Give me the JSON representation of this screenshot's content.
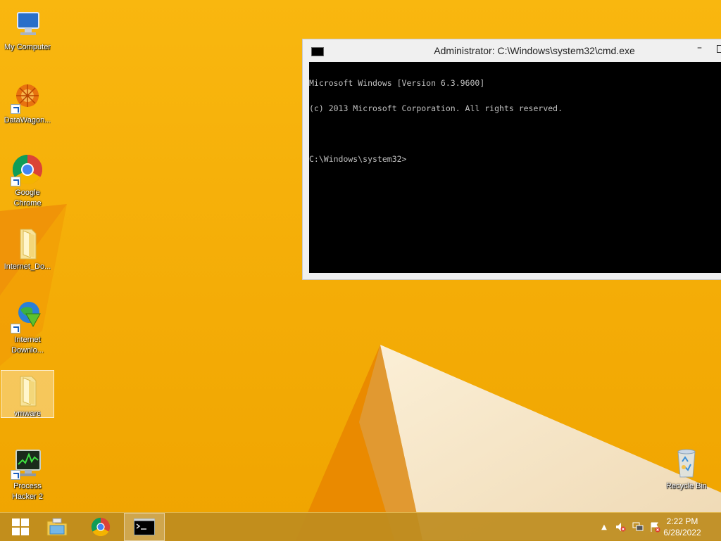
{
  "desktop": {
    "icons": [
      {
        "label": "My Computer",
        "icon": "computer-icon"
      },
      {
        "label": "DataWagon...",
        "icon": "datawagon-icon"
      },
      {
        "label": "Google Chrome",
        "icon": "chrome-icon"
      },
      {
        "label": "Internet_Do...",
        "icon": "folder-icon"
      },
      {
        "label": "Internet Downlo...",
        "icon": "idm-icon"
      },
      {
        "label": "vmware",
        "icon": "folder-icon"
      },
      {
        "label": "Process Hacker 2",
        "icon": "process-hacker-icon"
      },
      {
        "label": "Recycle Bin",
        "icon": "recycle-bin-icon"
      }
    ]
  },
  "cmd": {
    "title": "Administrator: C:\\Windows\\system32\\cmd.exe",
    "minimize": "–",
    "lines": [
      "Microsoft Windows [Version 6.3.9600]",
      "(c) 2013 Microsoft Corporation. All rights reserved.",
      "",
      "C:\\Windows\\system32>"
    ]
  },
  "taskbar": {
    "apps": [
      {
        "name": "start",
        "icon": "windows-logo-icon"
      },
      {
        "name": "file-explorer",
        "icon": "file-explorer-icon"
      },
      {
        "name": "chrome",
        "icon": "chrome-icon"
      },
      {
        "name": "cmd",
        "icon": "cmd-icon",
        "active": true
      }
    ],
    "clock": {
      "time": "2:22 PM",
      "date": "6/28/2022"
    }
  },
  "colors": {
    "wallpaper_base": "#f5b800",
    "wallpaper_dark": "#e98a00",
    "cream": "#f4e3c4",
    "taskbar": "#be8c1e"
  }
}
